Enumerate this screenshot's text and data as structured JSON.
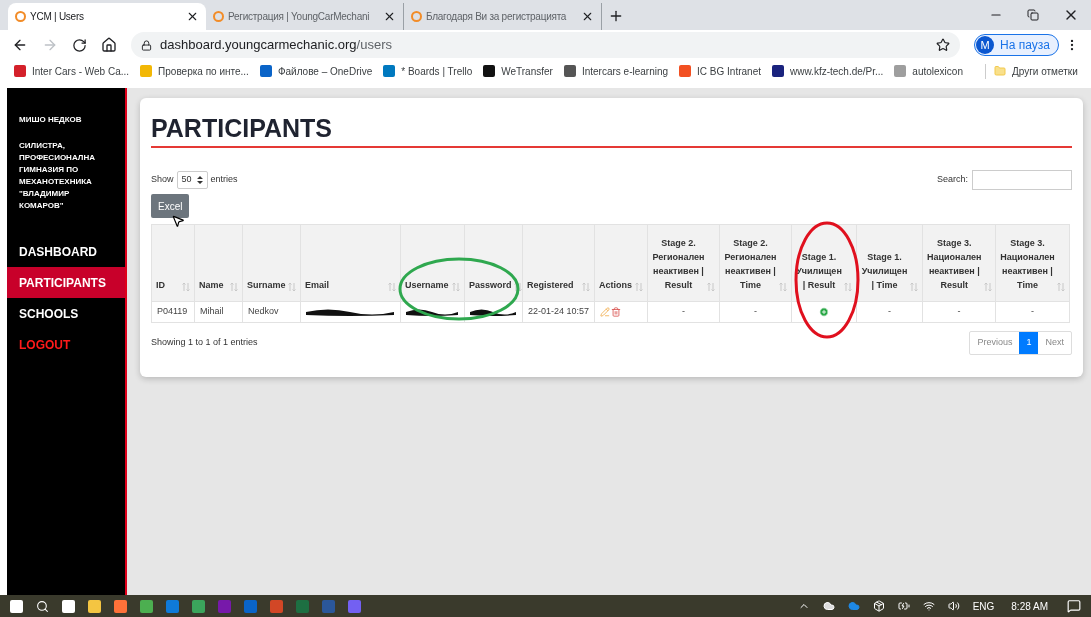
{
  "browser": {
    "tabs": [
      {
        "title": "YCM | Users",
        "selected": true
      },
      {
        "title": "Регистрация | YoungCarMechani",
        "selected": false
      },
      {
        "title": "Благодаря Ви за регистрацията",
        "selected": false
      }
    ],
    "address": {
      "host": "dashboard.youngcarmechanic.org",
      "path": "/users"
    },
    "profile": {
      "initial": "M",
      "label": "На пауза"
    },
    "bookmarks": [
      {
        "label": "Inter Cars - Web Ca...",
        "color": "#d4202a"
      },
      {
        "label": "Проверка по инте...",
        "color": "#f2b705"
      },
      {
        "label": "Файлове – OneDrive",
        "color": "#0a64c8"
      },
      {
        "label": "* Boards | Trello",
        "color": "#0079bf"
      },
      {
        "label": "WeTransfer",
        "color": "#111111"
      },
      {
        "label": "Intercars e-learning",
        "color": "#555555"
      },
      {
        "label": "IC BG Intranet",
        "color": "#f25022"
      },
      {
        "label": "www.kfz-tech.de/Pr...",
        "color": "#1a237e"
      },
      {
        "label": "autolexicon",
        "color": "#9e9e9e"
      }
    ],
    "other_bookmarks": "Други отметки"
  },
  "sidebar": {
    "user": "МИШО НЕДКОВ",
    "school": "СИЛИСТРА, ПРОФЕСИОНАЛНА ГИМНАЗИЯ ПО МЕХАНОТЕХНИКА \"ВЛАДИМИР КОМАРОВ\"",
    "items": [
      {
        "label": "DASHBOARD",
        "selected": false,
        "kind": "link"
      },
      {
        "label": "PARTICIPANTS",
        "selected": true,
        "kind": "link"
      },
      {
        "label": "SCHOOLS",
        "selected": false,
        "kind": "link"
      },
      {
        "label": "LOGOUT",
        "selected": false,
        "kind": "logout"
      }
    ]
  },
  "page": {
    "title": "PARTICIPANTS",
    "show_label": "Show",
    "page_size": "50",
    "entries_label": "entries",
    "search_label": "Search:",
    "excel_button": "Excel",
    "table": {
      "columns": [
        {
          "label": "ID"
        },
        {
          "label": "Name"
        },
        {
          "label": "Surname"
        },
        {
          "label": "Email"
        },
        {
          "label": "Username"
        },
        {
          "label": "Password"
        },
        {
          "label": "Registered"
        },
        {
          "label": "Actions"
        },
        {
          "label": "Stage 2. Регионален неактивен | Result"
        },
        {
          "label": "Stage 2. Регионален неактивен | Time"
        },
        {
          "label": "Stage 1. Училищен | Result"
        },
        {
          "label": "Stage 1. Училищен | Time"
        },
        {
          "label": "Stage 3. Национален неактивен | Result"
        },
        {
          "label": "Stage 3. Национален неактивен | Time"
        }
      ],
      "rows": [
        {
          "cells": [
            {
              "kind": "text",
              "text": "P04119"
            },
            {
              "kind": "text",
              "text": "Mihail"
            },
            {
              "kind": "text",
              "text": "Nedkov"
            },
            {
              "kind": "redacted"
            },
            {
              "kind": "redacted"
            },
            {
              "kind": "redacted"
            },
            {
              "kind": "text",
              "text": "22-01-24 10:57"
            },
            {
              "kind": "actions"
            },
            {
              "kind": "text",
              "text": "-"
            },
            {
              "kind": "text",
              "text": "-"
            },
            {
              "kind": "add"
            },
            {
              "kind": "text",
              "text": "-"
            },
            {
              "kind": "text",
              "text": "-"
            },
            {
              "kind": "text",
              "text": "-"
            }
          ]
        }
      ]
    },
    "info": "Showing 1 to 1 of 1 entries",
    "pagination": [
      {
        "label": "Previous",
        "selected": false
      },
      {
        "label": "1",
        "selected": true
      },
      {
        "label": "Next",
        "selected": false
      }
    ]
  },
  "taskbar": {
    "language": "ENG",
    "time": "8:28 AM"
  }
}
